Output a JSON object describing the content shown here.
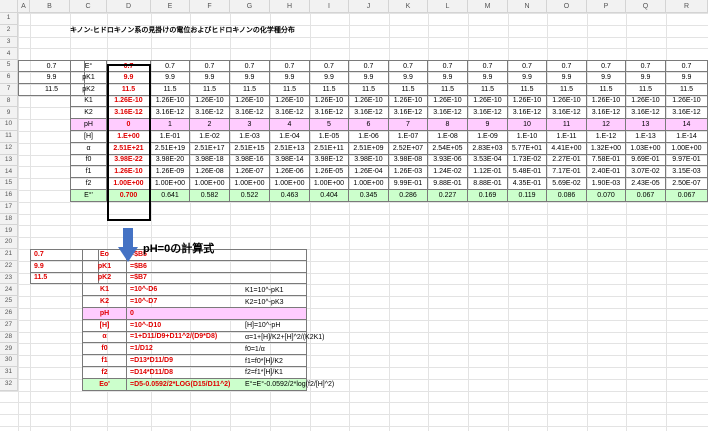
{
  "column_headers": [
    "A",
    "B",
    "C",
    "D",
    "E",
    "F",
    "G",
    "H",
    "I",
    "J",
    "K",
    "L",
    "M",
    "N",
    "O",
    "P",
    "Q",
    "R"
  ],
  "row_headers": [
    "1",
    "2",
    "3",
    "4",
    "5",
    "6",
    "7",
    "8",
    "9",
    "10",
    "11",
    "12",
    "13",
    "14",
    "15",
    "16",
    "17",
    "18",
    "19",
    "20",
    "21",
    "22",
    "23",
    "24",
    "25",
    "26",
    "27",
    "28",
    "29",
    "30",
    "31",
    "32"
  ],
  "title": "キノン-ヒドロキノン系の見掛けの電位およびヒドロキノンの化学種分布",
  "inputs_a": [
    "0.7",
    "9.9",
    "11.5"
  ],
  "labels_c": [
    "E°",
    "pK1",
    "pK2",
    "K1",
    "K2",
    "pH",
    "[H]",
    "α",
    "f0",
    "f1",
    "f2",
    "E°'"
  ],
  "table_rows": [
    [
      "0.7",
      "0.7",
      "0.7",
      "0.7",
      "0.7",
      "0.7",
      "0.7",
      "0.7",
      "0.7",
      "0.7",
      "0.7",
      "0.7",
      "0.7",
      "0.7",
      "0.7"
    ],
    [
      "9.9",
      "9.9",
      "9.9",
      "9.9",
      "9.9",
      "9.9",
      "9.9",
      "9.9",
      "9.9",
      "9.9",
      "9.9",
      "9.9",
      "9.9",
      "9.9",
      "9.9"
    ],
    [
      "11.5",
      "11.5",
      "11.5",
      "11.5",
      "11.5",
      "11.5",
      "11.5",
      "11.5",
      "11.5",
      "11.5",
      "11.5",
      "11.5",
      "11.5",
      "11.5",
      "11.5"
    ],
    [
      "1.26E-10",
      "1.26E-10",
      "1.26E-10",
      "1.26E-10",
      "1.26E-10",
      "1.26E-10",
      "1.26E-10",
      "1.26E-10",
      "1.26E-10",
      "1.26E-10",
      "1.26E-10",
      "1.26E-10",
      "1.26E-10",
      "1.26E-10",
      "1.26E-10"
    ],
    [
      "3.16E-12",
      "3.16E-12",
      "3.16E-12",
      "3.16E-12",
      "3.16E-12",
      "3.16E-12",
      "3.16E-12",
      "3.16E-12",
      "3.16E-12",
      "3.16E-12",
      "3.16E-12",
      "3.16E-12",
      "3.16E-12",
      "3.16E-12",
      "3.16E-12"
    ],
    [
      "0",
      "1",
      "2",
      "3",
      "4",
      "5",
      "6",
      "7",
      "8",
      "9",
      "10",
      "11",
      "12",
      "13",
      "14"
    ],
    [
      "1.E+00",
      "1.E-01",
      "1.E-02",
      "1.E-03",
      "1.E-04",
      "1.E-05",
      "1.E-06",
      "1.E-07",
      "1.E-08",
      "1.E-09",
      "1.E-10",
      "1.E-11",
      "1.E-12",
      "1.E-13",
      "1.E-14"
    ],
    [
      "2.51E+21",
      "2.51E+19",
      "2.51E+17",
      "2.51E+15",
      "2.51E+13",
      "2.51E+11",
      "2.51E+09",
      "2.52E+07",
      "2.54E+05",
      "2.83E+03",
      "5.77E+01",
      "4.41E+00",
      "1.32E+00",
      "1.03E+00",
      "1.00E+00"
    ],
    [
      "3.98E-22",
      "3.98E-20",
      "3.98E-18",
      "3.98E-16",
      "3.98E-14",
      "3.98E-12",
      "3.98E-10",
      "3.98E-08",
      "3.93E-06",
      "3.53E-04",
      "1.73E-02",
      "2.27E-01",
      "7.58E-01",
      "9.69E-01",
      "9.97E-01"
    ],
    [
      "1.26E-10",
      "1.26E-09",
      "1.26E-08",
      "1.26E-07",
      "1.26E-06",
      "1.26E-05",
      "1.26E-04",
      "1.26E-03",
      "1.24E-02",
      "1.12E-01",
      "5.48E-01",
      "7.17E-01",
      "2.40E-01",
      "3.07E-02",
      "3.15E-03"
    ],
    [
      "1.00E+00",
      "1.00E+00",
      "1.00E+00",
      "1.00E+00",
      "1.00E+00",
      "1.00E+00",
      "1.00E+00",
      "9.99E-01",
      "9.88E-01",
      "8.88E-01",
      "4.35E-01",
      "5.69E-02",
      "1.90E-03",
      "2.43E-05",
      "2.50E-07"
    ],
    [
      "0.700",
      "0.641",
      "0.582",
      "0.522",
      "0.463",
      "0.404",
      "0.345",
      "0.286",
      "0.227",
      "0.169",
      "0.119",
      "0.086",
      "0.070",
      "0.067",
      "0.067"
    ]
  ],
  "calc_label": "pH=0の計算式",
  "lower": {
    "a_values": [
      "0.7",
      "9.9",
      "11.5"
    ],
    "labels": [
      "Eo",
      "pK1",
      "pK2",
      "K1",
      "K2",
      "pH",
      "[H]",
      "α",
      "f0",
      "f1",
      "f2",
      "Eo'"
    ],
    "formulas": [
      "=$B5",
      "=$B6",
      "=$B7",
      "=10^-D6",
      "=10^-D7",
      "0",
      "=10^-D10",
      "=1+D11/D9+D11^2/(D9*D8)",
      "=1/D12",
      "=D13*D11/D9",
      "=D14*D11/D8",
      "=D5-0.0592/2*LOG(D15/D11^2)"
    ],
    "notes": [
      "",
      "",
      "",
      "K1=10^-pK1",
      "K2=10^-pK3",
      "",
      "[H]=10^-pH",
      "α=1+[H]/K2+[H]^2/(K2K1)",
      "f0=1/α",
      "f1=f0*[H]/K2",
      "f2=f1*[H]/K1",
      "E°=E°-0.0592/2*log(f2/[H]^2)"
    ]
  },
  "colors": {
    "red": "#e00000",
    "pink": "#ffccff",
    "green": "#ccffcc",
    "arrow": "#4472c4"
  }
}
